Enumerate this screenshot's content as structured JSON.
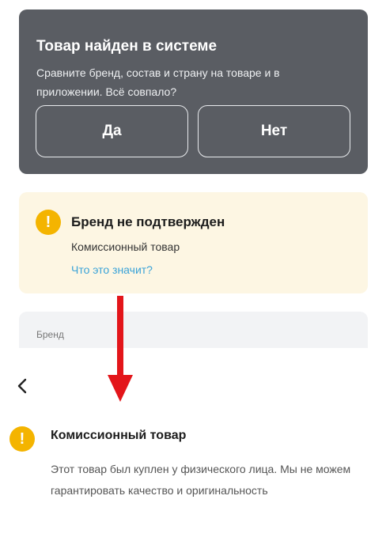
{
  "product_found": {
    "title": "Товар найден в системе",
    "description": "Сравните бренд, состав и страну на товаре и в приложении. Всё совпало?",
    "yes_label": "Да",
    "no_label": "Нет"
  },
  "brand_warning": {
    "icon": "exclamation-icon",
    "title": "Бренд не подтвержден",
    "subtitle": "Комиссионный товар",
    "link": "Что это значит?"
  },
  "brand_section": {
    "label": "Бренд"
  },
  "detail": {
    "back_icon": "chevron-left-icon",
    "icon": "exclamation-icon",
    "title": "Комиссионный товар",
    "body": "Этот товар был куплен у физического лица. Мы не можем гарантировать качество и оригинальность"
  },
  "colors": {
    "dark_card": "#5a5d63",
    "warning_bg": "#fdf6e3",
    "warning_icon": "#f4b400",
    "link": "#3aa3d8",
    "arrow": "#e3151a"
  }
}
